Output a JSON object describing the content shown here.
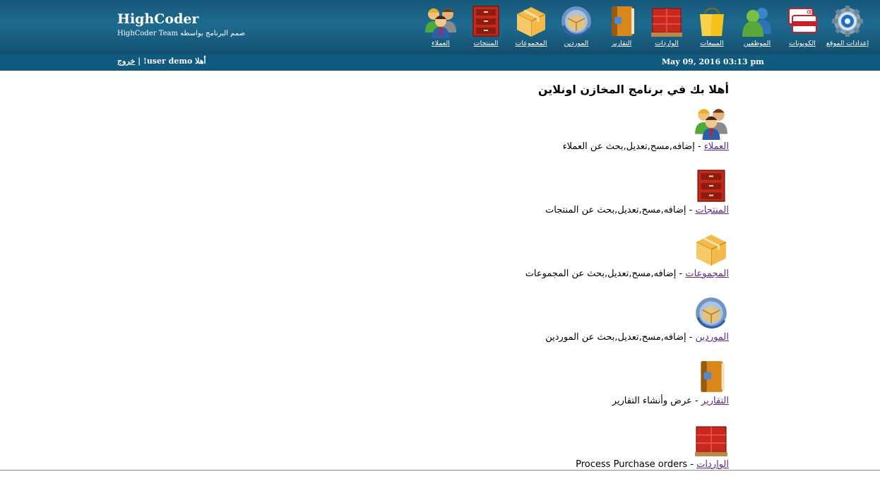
{
  "brand": {
    "title": "HighCoder",
    "subtitle": "صمم البرنامج بواسطه HighCoder Team"
  },
  "nav": {
    "items": [
      {
        "label": "إعدادات الموقع",
        "icon": "gear-icon"
      },
      {
        "label": "الكوبونات",
        "icon": "coupons-icon"
      },
      {
        "label": "الموظفين",
        "icon": "employees-icon"
      },
      {
        "label": "المبيعات",
        "icon": "shopping-bag-icon"
      },
      {
        "label": "الواردات",
        "icon": "pallet-icon"
      },
      {
        "label": "التقارير",
        "icon": "book-icon"
      },
      {
        "label": "الموردين",
        "icon": "suppliers-icon"
      },
      {
        "label": "المجموعات",
        "icon": "box-icon"
      },
      {
        "label": "المنتجات",
        "icon": "drawers-icon"
      },
      {
        "label": "العملاء",
        "icon": "customers-icon"
      }
    ]
  },
  "subbar": {
    "welcome_prefix": "أهلا",
    "username": "user demo",
    "welcome_suffix": "! |",
    "logout": "خروج",
    "datetime": "May 09, 2016 03:13 pm"
  },
  "main": {
    "heading": "أهلا بك في برنامج المخازن اونلاين",
    "entries": [
      {
        "link": "العملاء",
        "desc": " - إضافه,مسح,تعديل,بحث عن العملاء",
        "icon": "customers-icon"
      },
      {
        "link": "المنتجات",
        "desc": " - إضافه,مسح,تعديل,بحث عن المنتجات",
        "icon": "drawers-icon"
      },
      {
        "link": "المجموعات",
        "desc": " - إضافه,مسح,تعديل,بحث عن المجموعات",
        "icon": "box-icon"
      },
      {
        "link": "الموردين",
        "desc": " - إضافه,مسح,تعديل,بحث عن الموردين",
        "icon": "suppliers-icon"
      },
      {
        "link": "التقارير",
        "desc": " - عرض وأنشاء التقارير",
        "icon": "book-icon"
      },
      {
        "link": "الواردات",
        "desc": " - Process Purchase orders",
        "icon": "pallet-icon"
      }
    ]
  },
  "colors": {
    "header": "#1a6285",
    "subbar": "#0f5a7e",
    "link": "#5b2a86"
  }
}
